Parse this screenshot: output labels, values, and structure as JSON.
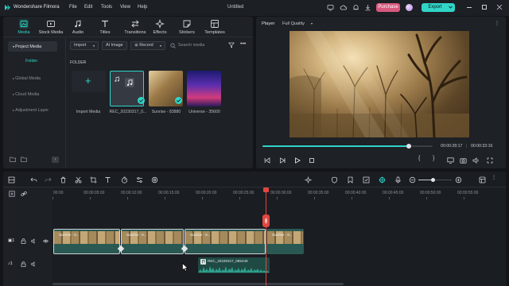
{
  "app": {
    "name": "Wondershare Filmora",
    "project_title": "Untitled",
    "menu": [
      "File",
      "Edit",
      "Tools",
      "View",
      "Help"
    ],
    "purchase_label": "Purchase",
    "export_label": "Export",
    "colors": {
      "accent": "#30d5c8",
      "purchase": "#d9587e",
      "playhead": "#e0463e",
      "audio": "#2f9f8c"
    }
  },
  "toolbar": {
    "tabs": [
      {
        "label": "Media",
        "icon": "media-icon"
      },
      {
        "label": "Stock Media",
        "icon": "stock-media-icon"
      },
      {
        "label": "Audio",
        "icon": "audio-icon"
      },
      {
        "label": "Titles",
        "icon": "titles-icon"
      },
      {
        "label": "Transitions",
        "icon": "transitions-icon"
      },
      {
        "label": "Effects",
        "icon": "effects-icon"
      },
      {
        "label": "Stickers",
        "icon": "stickers-icon"
      },
      {
        "label": "Templates",
        "icon": "templates-icon"
      }
    ]
  },
  "sidebar": {
    "items": [
      "Project Media",
      "Folder",
      "Global Media",
      "Cloud Media",
      "Adjustment Layer"
    ]
  },
  "media": {
    "import_label": "Import",
    "ai_image_label": "AI Image",
    "record_label": "Record",
    "search_placeholder": "Search media",
    "folder_label": "FOLDER",
    "import_tile_label": "Import Media",
    "items": [
      {
        "label": "REC_20230317_0..."
      },
      {
        "label": "Sunrise - 83880"
      },
      {
        "label": "Universe - 35600"
      }
    ]
  },
  "player": {
    "label": "Player",
    "quality": "Full Quality",
    "current_time": "00:00:28:17",
    "total_time": "00:00:33:16",
    "progress": 0.86
  },
  "timeline": {
    "ticks": [
      "00:00",
      "00:00:05:00",
      "00:00:10:00",
      "00:00:15:00",
      "00:00:20:00",
      "00:00:25:00",
      "00:00:30:00",
      "00:00:35:00",
      "00:00:40:00",
      "00:00:45:00",
      "00:00:50:00",
      "00:00:55:00"
    ],
    "video_clip_label": "Sunrise - 8...",
    "audio_clip_label": "REC_20230317_085449"
  }
}
